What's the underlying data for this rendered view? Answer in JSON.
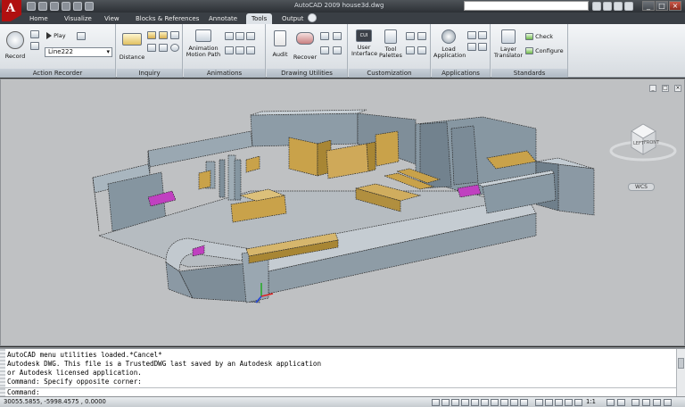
{
  "titlebar": {
    "title": "AutoCAD 2009 house3d.dwg",
    "win_minimize": "_",
    "win_restore": "□",
    "win_close": "×"
  },
  "tabs": [
    {
      "label": "Home"
    },
    {
      "label": "Visualize"
    },
    {
      "label": "View"
    },
    {
      "label": "Blocks & References"
    },
    {
      "label": "Annotate"
    },
    {
      "label": "Tools"
    },
    {
      "label": "Output"
    }
  ],
  "ribbon": {
    "action_recorder": {
      "title": "Action Recorder",
      "record": "Record",
      "play": "Play",
      "macro_select": "Line222"
    },
    "inquiry": {
      "title": "Inquiry",
      "distance": "Distance"
    },
    "animations": {
      "title": "Animations",
      "motion_path": "Animation\nMotion Path"
    },
    "drawing_utilities": {
      "title": "Drawing Utilities",
      "audit": "Audit",
      "recover": "Recover"
    },
    "customization": {
      "title": "Customization",
      "user_interface": "User\nInterface",
      "tool_palettes": "Tool\nPalettes",
      "cui_badge": "CUI"
    },
    "applications": {
      "title": "Applications",
      "load_application": "Load\nApplication"
    },
    "standards": {
      "title": "Standards",
      "layer_translator": "Layer\nTranslator",
      "check": "Check",
      "configure": "Configure"
    }
  },
  "viewport": {
    "viewcube_left": "LEFT",
    "viewcube_front": "FRONT",
    "wcs": "WCS",
    "colors": {
      "wall": "#8c9ba6",
      "furniture": "#c9a24a",
      "accent": "#c040c0",
      "background": "#bfc1c3"
    }
  },
  "command_line": {
    "history": [
      "AutoCAD menu utilities loaded.*Cancel*",
      "Autodesk DWG.  This file is a TrustedDWG last saved by an Autodesk application",
      "or Autodesk licensed application.",
      "Command: Specify opposite corner:"
    ],
    "prompt": "Command:"
  },
  "statusbar": {
    "coordinates": "30055.5855, -5998.4575 , 0.0000",
    "scale": "1:1"
  }
}
